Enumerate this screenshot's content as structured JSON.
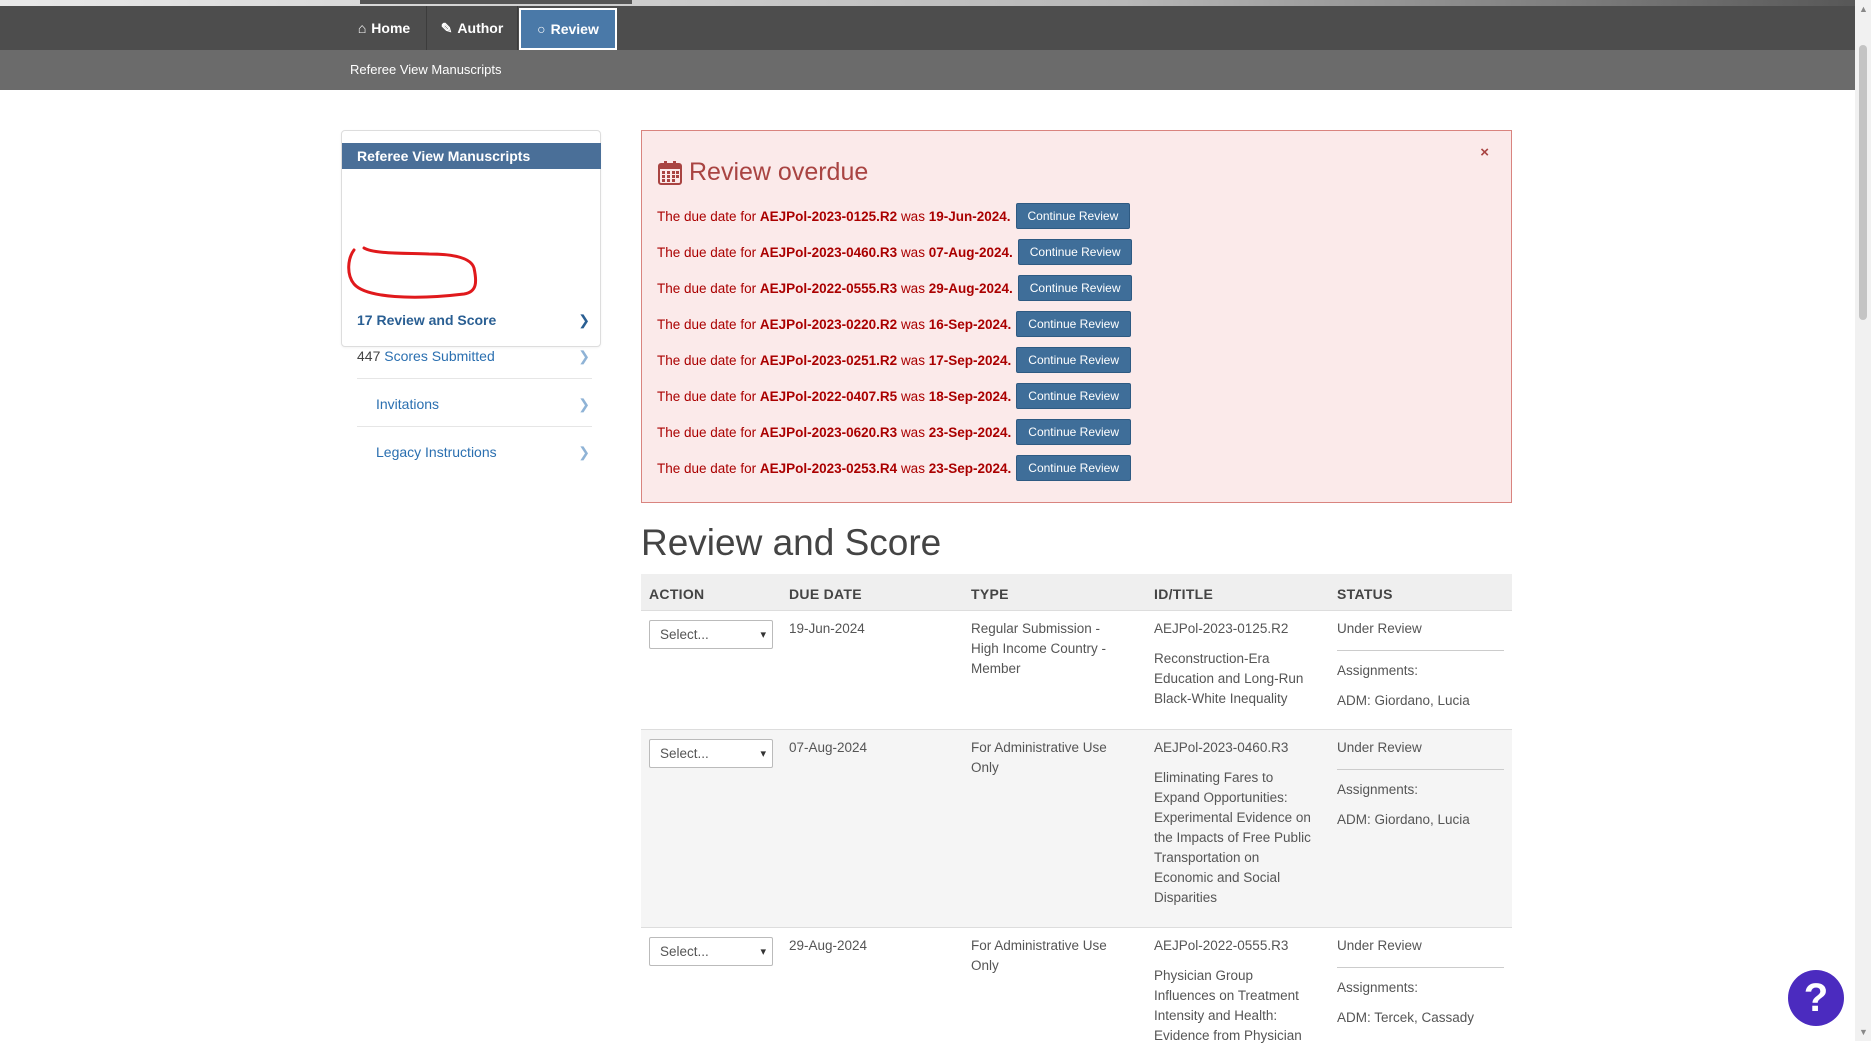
{
  "nav": {
    "tabs": [
      {
        "label": "Home",
        "icon": "home-icon"
      },
      {
        "label": "Author",
        "icon": "pencil-icon"
      },
      {
        "label": "Review",
        "icon": "comment-icon"
      }
    ],
    "subnav_label": "Referee View Manuscripts"
  },
  "sidebar": {
    "title": "Referee View Manuscripts",
    "items": [
      {
        "count": "17",
        "label": "Review and Score"
      },
      {
        "count": "447",
        "label": "Scores Submitted"
      },
      {
        "count": "",
        "label": "Invitations"
      },
      {
        "count": "",
        "label": "Legacy Instructions"
      }
    ]
  },
  "alert": {
    "title": "Review overdue",
    "close": "×",
    "prefix": "The due date for",
    "was": "was",
    "button_label": "Continue Review",
    "rows": [
      {
        "id": "AEJPol-2023-0125.R2",
        "date": "19-Jun-2024."
      },
      {
        "id": "AEJPol-2023-0460.R3",
        "date": "07-Aug-2024."
      },
      {
        "id": "AEJPol-2022-0555.R3",
        "date": "29-Aug-2024."
      },
      {
        "id": "AEJPol-2023-0220.R2",
        "date": "16-Sep-2024."
      },
      {
        "id": "AEJPol-2023-0251.R2",
        "date": "17-Sep-2024."
      },
      {
        "id": "AEJPol-2022-0407.R5",
        "date": "18-Sep-2024."
      },
      {
        "id": "AEJPol-2023-0620.R3",
        "date": "23-Sep-2024."
      },
      {
        "id": "AEJPol-2023-0253.R4",
        "date": "23-Sep-2024."
      }
    ]
  },
  "section_title": "Review and Score",
  "table": {
    "headers": [
      "ACTION",
      "DUE DATE",
      "TYPE",
      "ID/TITLE",
      "STATUS"
    ],
    "select_placeholder": "Select...",
    "assignments_label": "Assignments:",
    "rows": [
      {
        "due": "19-Jun-2024",
        "type": [
          "Regular Submission -",
          "High Income Country -",
          "Member"
        ],
        "id": "AEJPol-2023-0125.R2",
        "title": [
          "Reconstruction-Era",
          "Education and Long-Run",
          "Black-White Inequality"
        ],
        "status": "Under Review",
        "assignment": "ADM: Giordano, Lucia"
      },
      {
        "due": "07-Aug-2024",
        "type": [
          "For Administrative Use",
          "Only"
        ],
        "id": "AEJPol-2023-0460.R3",
        "title": [
          "Eliminating Fares to",
          "Expand Opportunities:",
          "Experimental Evidence on",
          "the Impacts of Free Public",
          "Transportation on",
          "Economic and Social",
          "Disparities"
        ],
        "status": "Under Review",
        "assignment": "ADM: Giordano, Lucia"
      },
      {
        "due": "29-Aug-2024",
        "type": [
          "For Administrative Use",
          "Only"
        ],
        "id": "AEJPol-2022-0555.R3",
        "title": [
          "Physician Group",
          "Influences on Treatment",
          "Intensity and Health:",
          "Evidence from Physician"
        ],
        "status": "Under Review",
        "assignment": "ADM: Tercek, Cassady"
      }
    ]
  },
  "help_label": "?"
}
